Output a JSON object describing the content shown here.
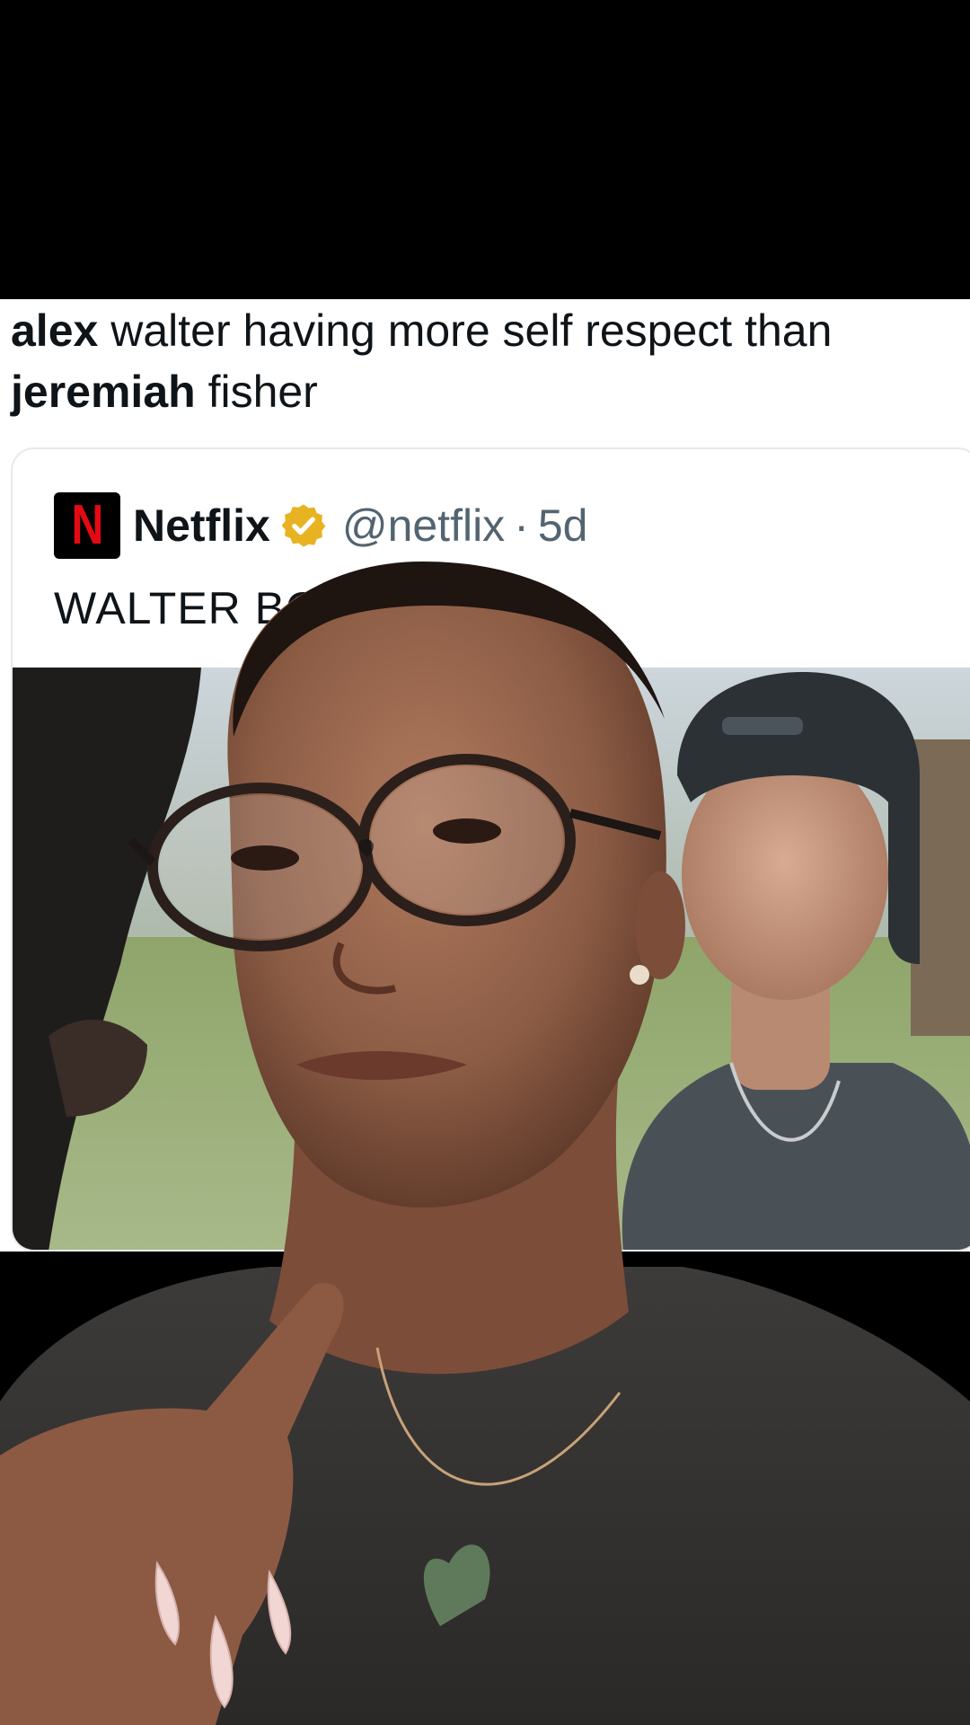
{
  "caption": {
    "name1": "alex",
    "text1": " walter having more self respect than ",
    "name2": "jeremiah",
    "text2": " fisher"
  },
  "quote": {
    "logo_letter": "N",
    "display_name": "Netflix",
    "verified_icon": "verified-badge-icon",
    "handle": "@netflix",
    "separator": "·",
    "age": "5d",
    "text": "WALTER BO        ACK."
  },
  "colors": {
    "text_primary": "#0f1419",
    "text_secondary": "#536471",
    "netflix_red": "#e50914",
    "verified_gold": "#e8b323",
    "card_border": "#e6e9ec"
  }
}
